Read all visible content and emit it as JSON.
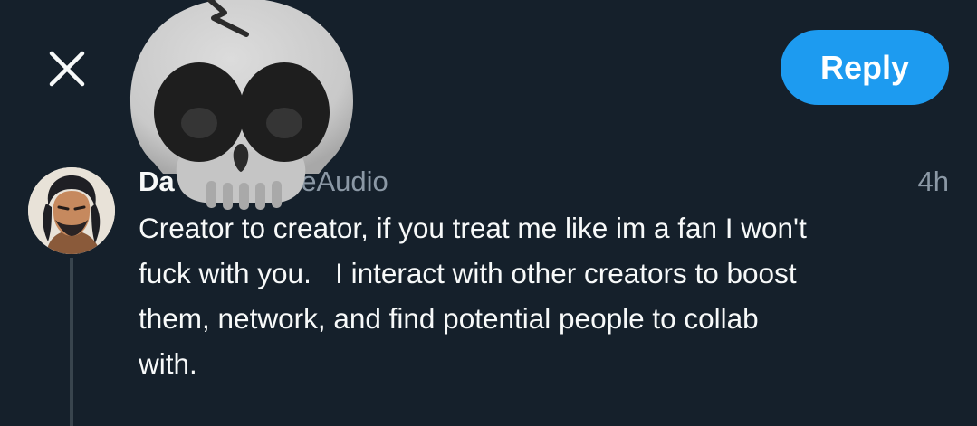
{
  "toolbar": {
    "close_icon": "close-icon",
    "reply_label": "Reply",
    "reply_color": "#1d9bf0"
  },
  "tweet": {
    "author_name": "Da",
    "author_handle": "deAudio",
    "timestamp": "4h",
    "text": "Creator to creator, if you treat me like im a fan I won't\nfuck with you.   I interact with other creators to boost\nthem, network, and find potential people to collab\nwith."
  },
  "overlay": {
    "emoji": "skull-emoji"
  },
  "colors": {
    "background": "#15202b",
    "primary_text": "#f7f9f9",
    "secondary_text": "#8b98a5",
    "thread_line": "#38444d"
  }
}
